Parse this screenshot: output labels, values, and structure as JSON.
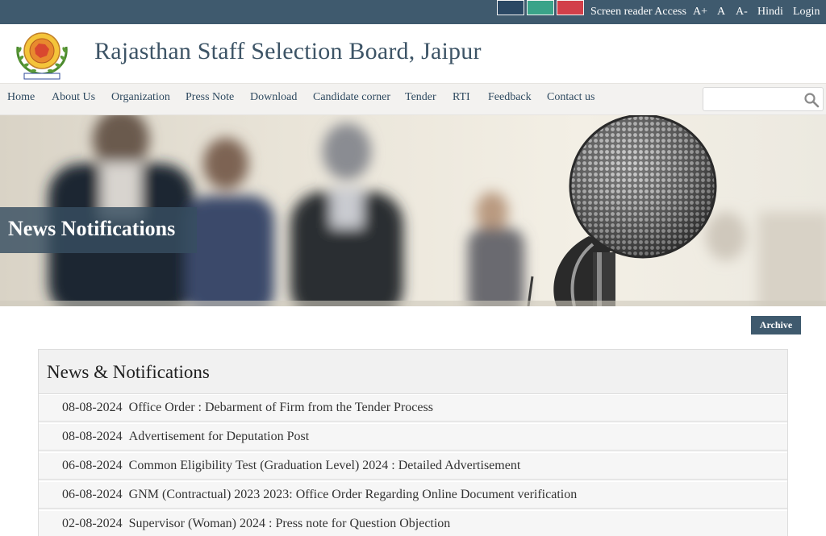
{
  "topbar": {
    "theme_colors": [
      "#2b4864",
      "#3aa389",
      "#d23f4a"
    ],
    "screen_reader": "Screen reader Access",
    "font_increase": "A+",
    "font_normal": "A",
    "font_decrease": "A-",
    "language": "Hindi",
    "login": "Login"
  },
  "header": {
    "title": "Rajasthan Staff Selection Board, Jaipur"
  },
  "nav": {
    "items": [
      "Home",
      "About Us",
      "Organization",
      "Press Note",
      "Download",
      "Candidate corner",
      "Tender",
      "RTI",
      "Feedback",
      "Contact us"
    ],
    "search_placeholder": ""
  },
  "banner": {
    "title": "News Notifications"
  },
  "archive": {
    "label": "Archive"
  },
  "news": {
    "heading": "News & Notifications",
    "items": [
      {
        "date": "08-08-2024",
        "title": "Office Order : Debarment of Firm from the Tender Process"
      },
      {
        "date": "08-08-2024",
        "title": "Advertisement for Deputation Post"
      },
      {
        "date": "06-08-2024",
        "title": "Common Eligibility Test (Graduation Level) 2024 : Detailed Advertisement"
      },
      {
        "date": "06-08-2024",
        "title": "GNM (Contractual) 2023 2023: Office Order Regarding Online Document verification"
      },
      {
        "date": "02-08-2024",
        "title": "Supervisor (Woman) 2024 : Press note for Question Objection"
      }
    ]
  },
  "colors": {
    "topbar_bg": "#3f5a6e",
    "title_color": "#3d5466",
    "nav_bg": "#f3f2f0"
  }
}
